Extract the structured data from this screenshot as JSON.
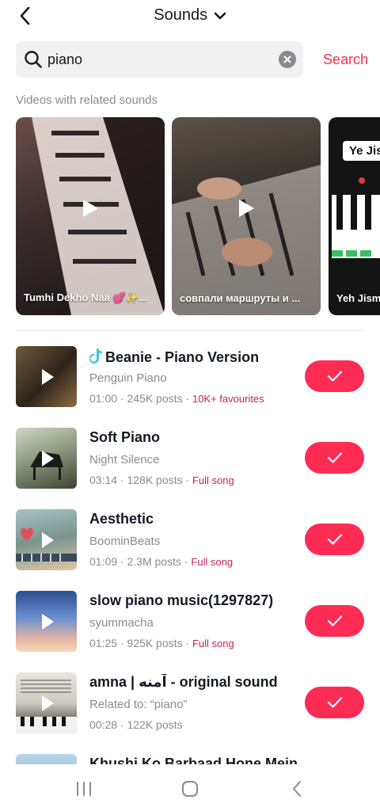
{
  "header": {
    "title": "Sounds"
  },
  "search": {
    "query": "piano",
    "button_label": "Search"
  },
  "section": {
    "related_label": "Videos with related sounds"
  },
  "videos": [
    {
      "caption": "Tumhi Dekho Naa 💕✨..."
    },
    {
      "caption": "совпали маршруты и ..."
    },
    {
      "caption": "Yeh Jism",
      "overlay_text": "Ye Jis"
    }
  ],
  "sounds": [
    {
      "title": "Beanie - Piano Version",
      "artist": "Penguin Piano",
      "meta": "01:00 · 245K posts · ",
      "tag": "10K+ favourites",
      "original": true
    },
    {
      "title": "Soft Piano",
      "artist": "Night Silence",
      "meta": "03:14 · 128K posts · ",
      "tag": "Full song"
    },
    {
      "title": "Aesthetic",
      "artist": "BoominBeats",
      "meta": "01:09 · 2.3M posts · ",
      "tag": "Full song"
    },
    {
      "title": "slow piano music(1297827)",
      "artist": "syummacha",
      "meta": "01:25 · 925K posts · ",
      "tag": "Full song"
    },
    {
      "title": "amna | آمنه - original sound",
      "artist": "Related to: “piano”",
      "meta": "00:28 · 122K posts",
      "tag": ""
    },
    {
      "title": "Khushi Ko Barbaad Hone Mein",
      "artist": "",
      "meta": "",
      "tag": ""
    }
  ],
  "colors": {
    "accent": "#fe2c55",
    "tag": "#c4255a",
    "muted": "#8a8b91"
  }
}
